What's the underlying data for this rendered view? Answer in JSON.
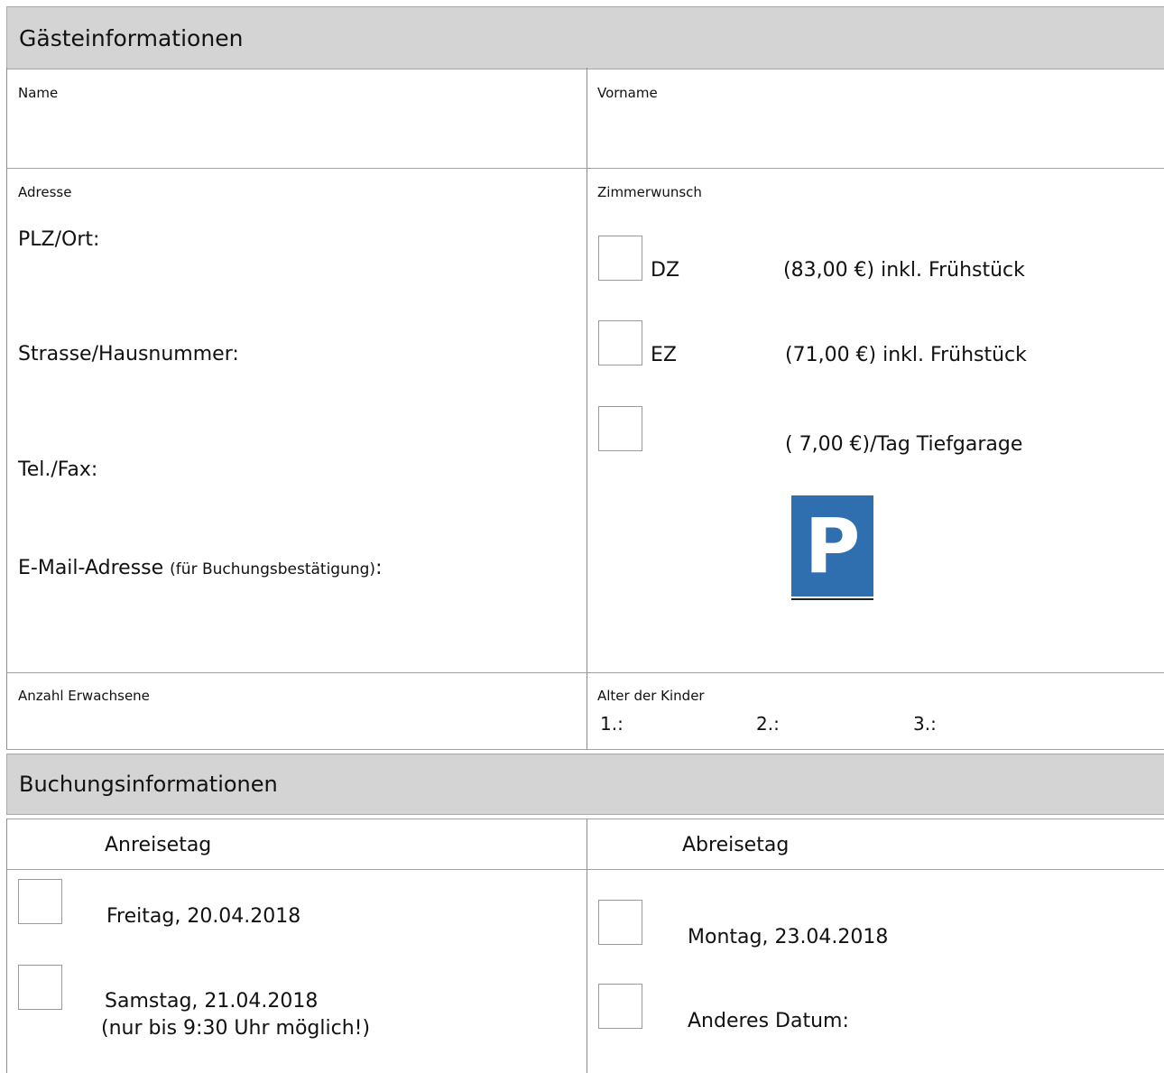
{
  "sections": {
    "guest_title": "Gästeinformationen",
    "booking_title": "Buchungsinformationen"
  },
  "guest": {
    "name_label": "Name",
    "vorname_label": "Vorname",
    "adresse_label": "Adresse",
    "zimmerwunsch_label": "Zimmerwunsch",
    "plz_label": "PLZ/Ort:",
    "strasse_label": "Strasse/Hausnummer:",
    "tel_label": "Tel./Fax:",
    "email_label": "E-Mail-Adresse",
    "email_note": "(für Buchungsbestätigung)",
    "email_colon": ":",
    "adults_label": "Anzahl Erwachsene",
    "children_label": "Alter der Kinder",
    "child1": "1.:",
    "child2": "2.:",
    "child3": "3.:"
  },
  "rooms": [
    {
      "code": "DZ",
      "price": "(83,00 €) inkl. Frühstück"
    },
    {
      "code": "EZ",
      "price": "(71,00 €) inkl. Frühstück"
    },
    {
      "code": "",
      "price": "( 7,00 €)/Tag  Tiefgarage"
    }
  ],
  "parking_sign": "P",
  "booking": {
    "arrival_label": "Anreisetag",
    "departure_label": "Abreisetag",
    "arrival_options": [
      "Freitag, 20.04.2018",
      "Samstag, 21.04.2018"
    ],
    "arrival_note": "(nur bis 9:30 Uhr möglich!)",
    "departure_options": [
      "Montag, 23.04.2018",
      "Anderes Datum:"
    ]
  },
  "colors": {
    "header_bg": "#d4d4d4",
    "parking_blue": "#2f6fb0"
  }
}
